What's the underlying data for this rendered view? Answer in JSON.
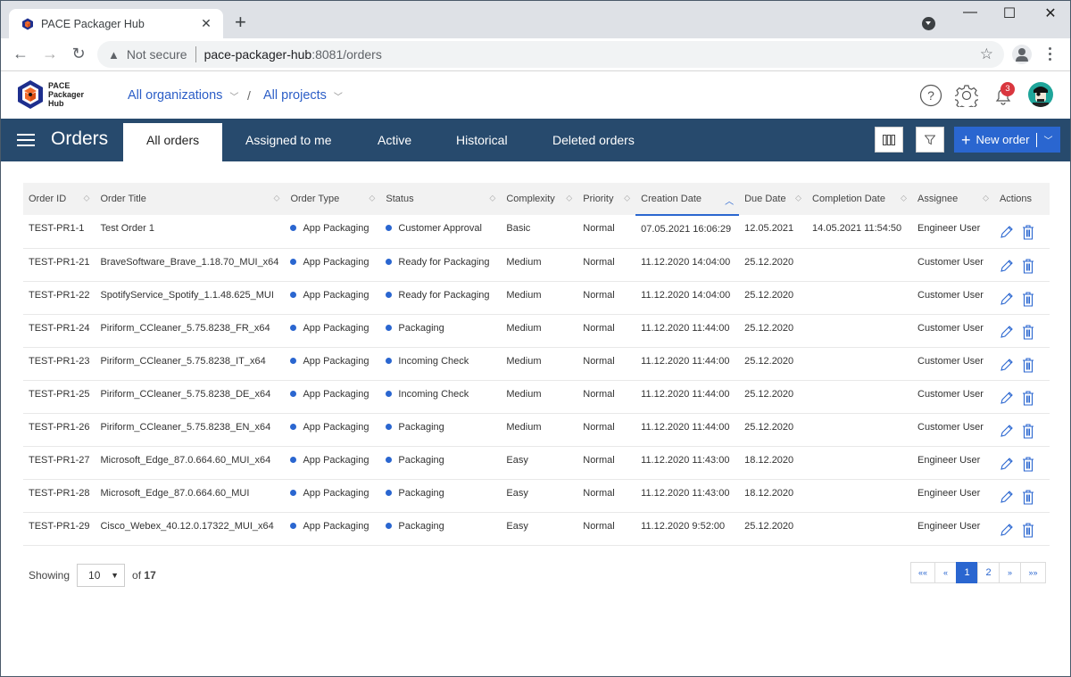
{
  "browser": {
    "tab_title": "PACE Packager Hub",
    "new_tab_label": "+",
    "close_tab_label": "✕",
    "security_label": "Not secure",
    "url_host": "pace-packager-hub",
    "url_rest": ":8081/orders",
    "window_controls": {
      "minimize": "—",
      "maximize": "☐",
      "close": "✕"
    }
  },
  "header": {
    "logo_lines": [
      "PACE",
      "Packager",
      "Hub"
    ],
    "org_selector": "All organizations",
    "project_selector": "All projects",
    "breadcrumb_separator": "/",
    "notification_count": "3"
  },
  "navbar": {
    "title": "Orders",
    "tabs": [
      {
        "label": "All orders",
        "active": true
      },
      {
        "label": "Assigned to me",
        "active": false
      },
      {
        "label": "Active",
        "active": false
      },
      {
        "label": "Historical",
        "active": false
      },
      {
        "label": "Deleted orders",
        "active": false
      }
    ],
    "new_order_label": "New order"
  },
  "table": {
    "columns": [
      "Order ID",
      "Order Title",
      "Order Type",
      "Status",
      "Complexity",
      "Priority",
      "Creation Date",
      "Due Date",
      "Completion Date",
      "Assignee",
      "Actions"
    ],
    "sorted_column": "Creation Date",
    "sort_direction": "ascending",
    "rows": [
      [
        "TEST-PR1-1",
        "Test Order 1",
        "App Packaging",
        "Customer Approval",
        "Basic",
        "Normal",
        "07.05.2021 16:06:29",
        "12.05.2021",
        "14.05.2021 11:54:50",
        "Engineer User"
      ],
      [
        "TEST-PR1-21",
        "BraveSoftware_Brave_1.18.70_MUI_x64",
        "App Packaging",
        "Ready for Packaging",
        "Medium",
        "Normal",
        "11.12.2020 14:04:00",
        "25.12.2020",
        "",
        "Customer User"
      ],
      [
        "TEST-PR1-22",
        "SpotifyService_Spotify_1.1.48.625_MUI",
        "App Packaging",
        "Ready for Packaging",
        "Medium",
        "Normal",
        "11.12.2020 14:04:00",
        "25.12.2020",
        "",
        "Customer User"
      ],
      [
        "TEST-PR1-24",
        "Piriform_CCleaner_5.75.8238_FR_x64",
        "App Packaging",
        "Packaging",
        "Medium",
        "Normal",
        "11.12.2020 11:44:00",
        "25.12.2020",
        "",
        "Customer User"
      ],
      [
        "TEST-PR1-23",
        "Piriform_CCleaner_5.75.8238_IT_x64",
        "App Packaging",
        "Incoming Check",
        "Medium",
        "Normal",
        "11.12.2020 11:44:00",
        "25.12.2020",
        "",
        "Customer User"
      ],
      [
        "TEST-PR1-25",
        "Piriform_CCleaner_5.75.8238_DE_x64",
        "App Packaging",
        "Incoming Check",
        "Medium",
        "Normal",
        "11.12.2020 11:44:00",
        "25.12.2020",
        "",
        "Customer User"
      ],
      [
        "TEST-PR1-26",
        "Piriform_CCleaner_5.75.8238_EN_x64",
        "App Packaging",
        "Packaging",
        "Medium",
        "Normal",
        "11.12.2020 11:44:00",
        "25.12.2020",
        "",
        "Customer User"
      ],
      [
        "TEST-PR1-27",
        "Microsoft_Edge_87.0.664.60_MUI_x64",
        "App Packaging",
        "Packaging",
        "Easy",
        "Normal",
        "11.12.2020 11:43:00",
        "18.12.2020",
        "",
        "Engineer User"
      ],
      [
        "TEST-PR1-28",
        "Microsoft_Edge_87.0.664.60_MUI",
        "App Packaging",
        "Packaging",
        "Easy",
        "Normal",
        "11.12.2020 11:43:00",
        "18.12.2020",
        "",
        "Engineer User"
      ],
      [
        "TEST-PR1-29",
        "Cisco_Webex_40.12.0.17322_MUI_x64",
        "App Packaging",
        "Packaging",
        "Easy",
        "Normal",
        "11.12.2020 9:52:00",
        "25.12.2020",
        "",
        "Engineer User"
      ]
    ]
  },
  "footer": {
    "showing_label": "Showing",
    "page_size": "10",
    "of_label": "of",
    "total": "17",
    "pager": [
      "««",
      "«",
      "1",
      "2",
      "»",
      "»»"
    ],
    "current_page": "1"
  },
  "colors": {
    "navbar": "#274a6d",
    "accent": "#2a66d0",
    "badge": "#d9363e"
  }
}
